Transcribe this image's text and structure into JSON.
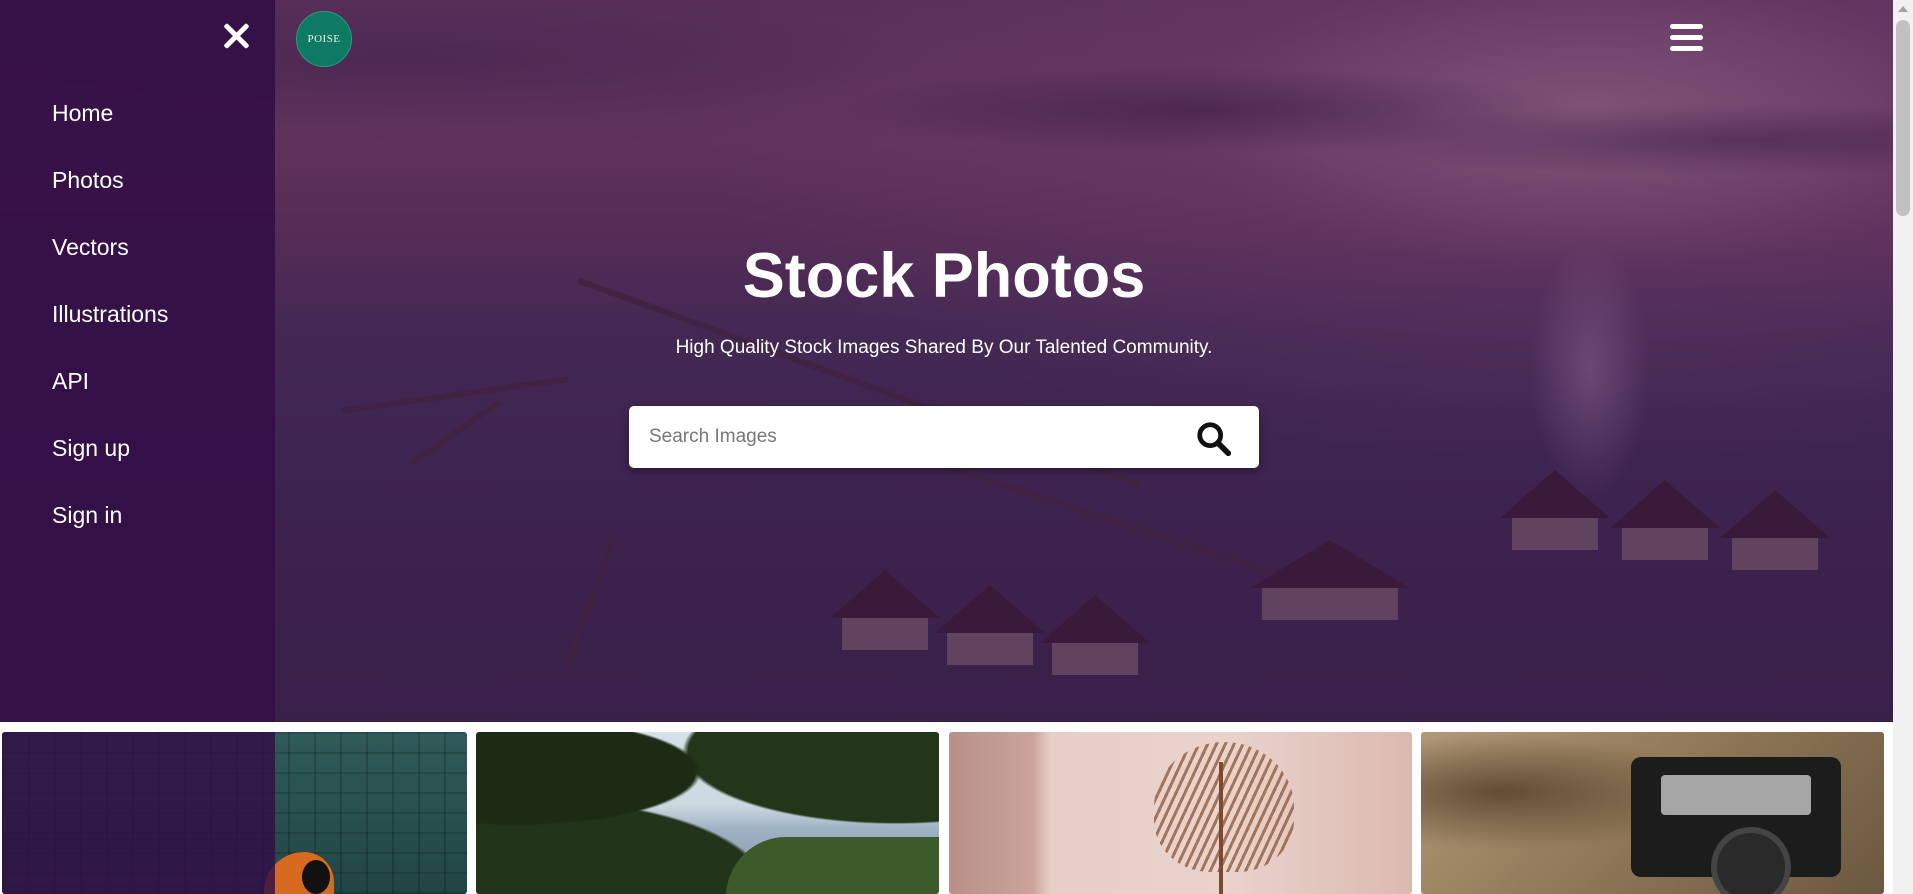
{
  "brand": {
    "logo_text": "POISE",
    "accent": "#0e7a63"
  },
  "sidebar": {
    "background": "#320e46",
    "close_icon": "close-icon",
    "items": [
      {
        "label": "Home"
      },
      {
        "label": "Photos"
      },
      {
        "label": "Vectors"
      },
      {
        "label": "Illustrations"
      },
      {
        "label": "API"
      },
      {
        "label": "Sign up"
      },
      {
        "label": "Sign in"
      }
    ]
  },
  "header": {
    "menu_icon": "hamburger-icon"
  },
  "hero": {
    "title": "Stock Photos",
    "subtitle": "High Quality Stock Images Shared By Our Talented Community."
  },
  "search": {
    "placeholder": "Search Images",
    "value": "",
    "icon": "search-icon"
  },
  "gallery": {
    "images": [
      {
        "subject": "motorcycle-against-tiled-wall"
      },
      {
        "subject": "coastline-through-leaves"
      },
      {
        "subject": "pampas-grass-in-vase"
      },
      {
        "subject": "vintage-camera-on-map"
      }
    ]
  }
}
